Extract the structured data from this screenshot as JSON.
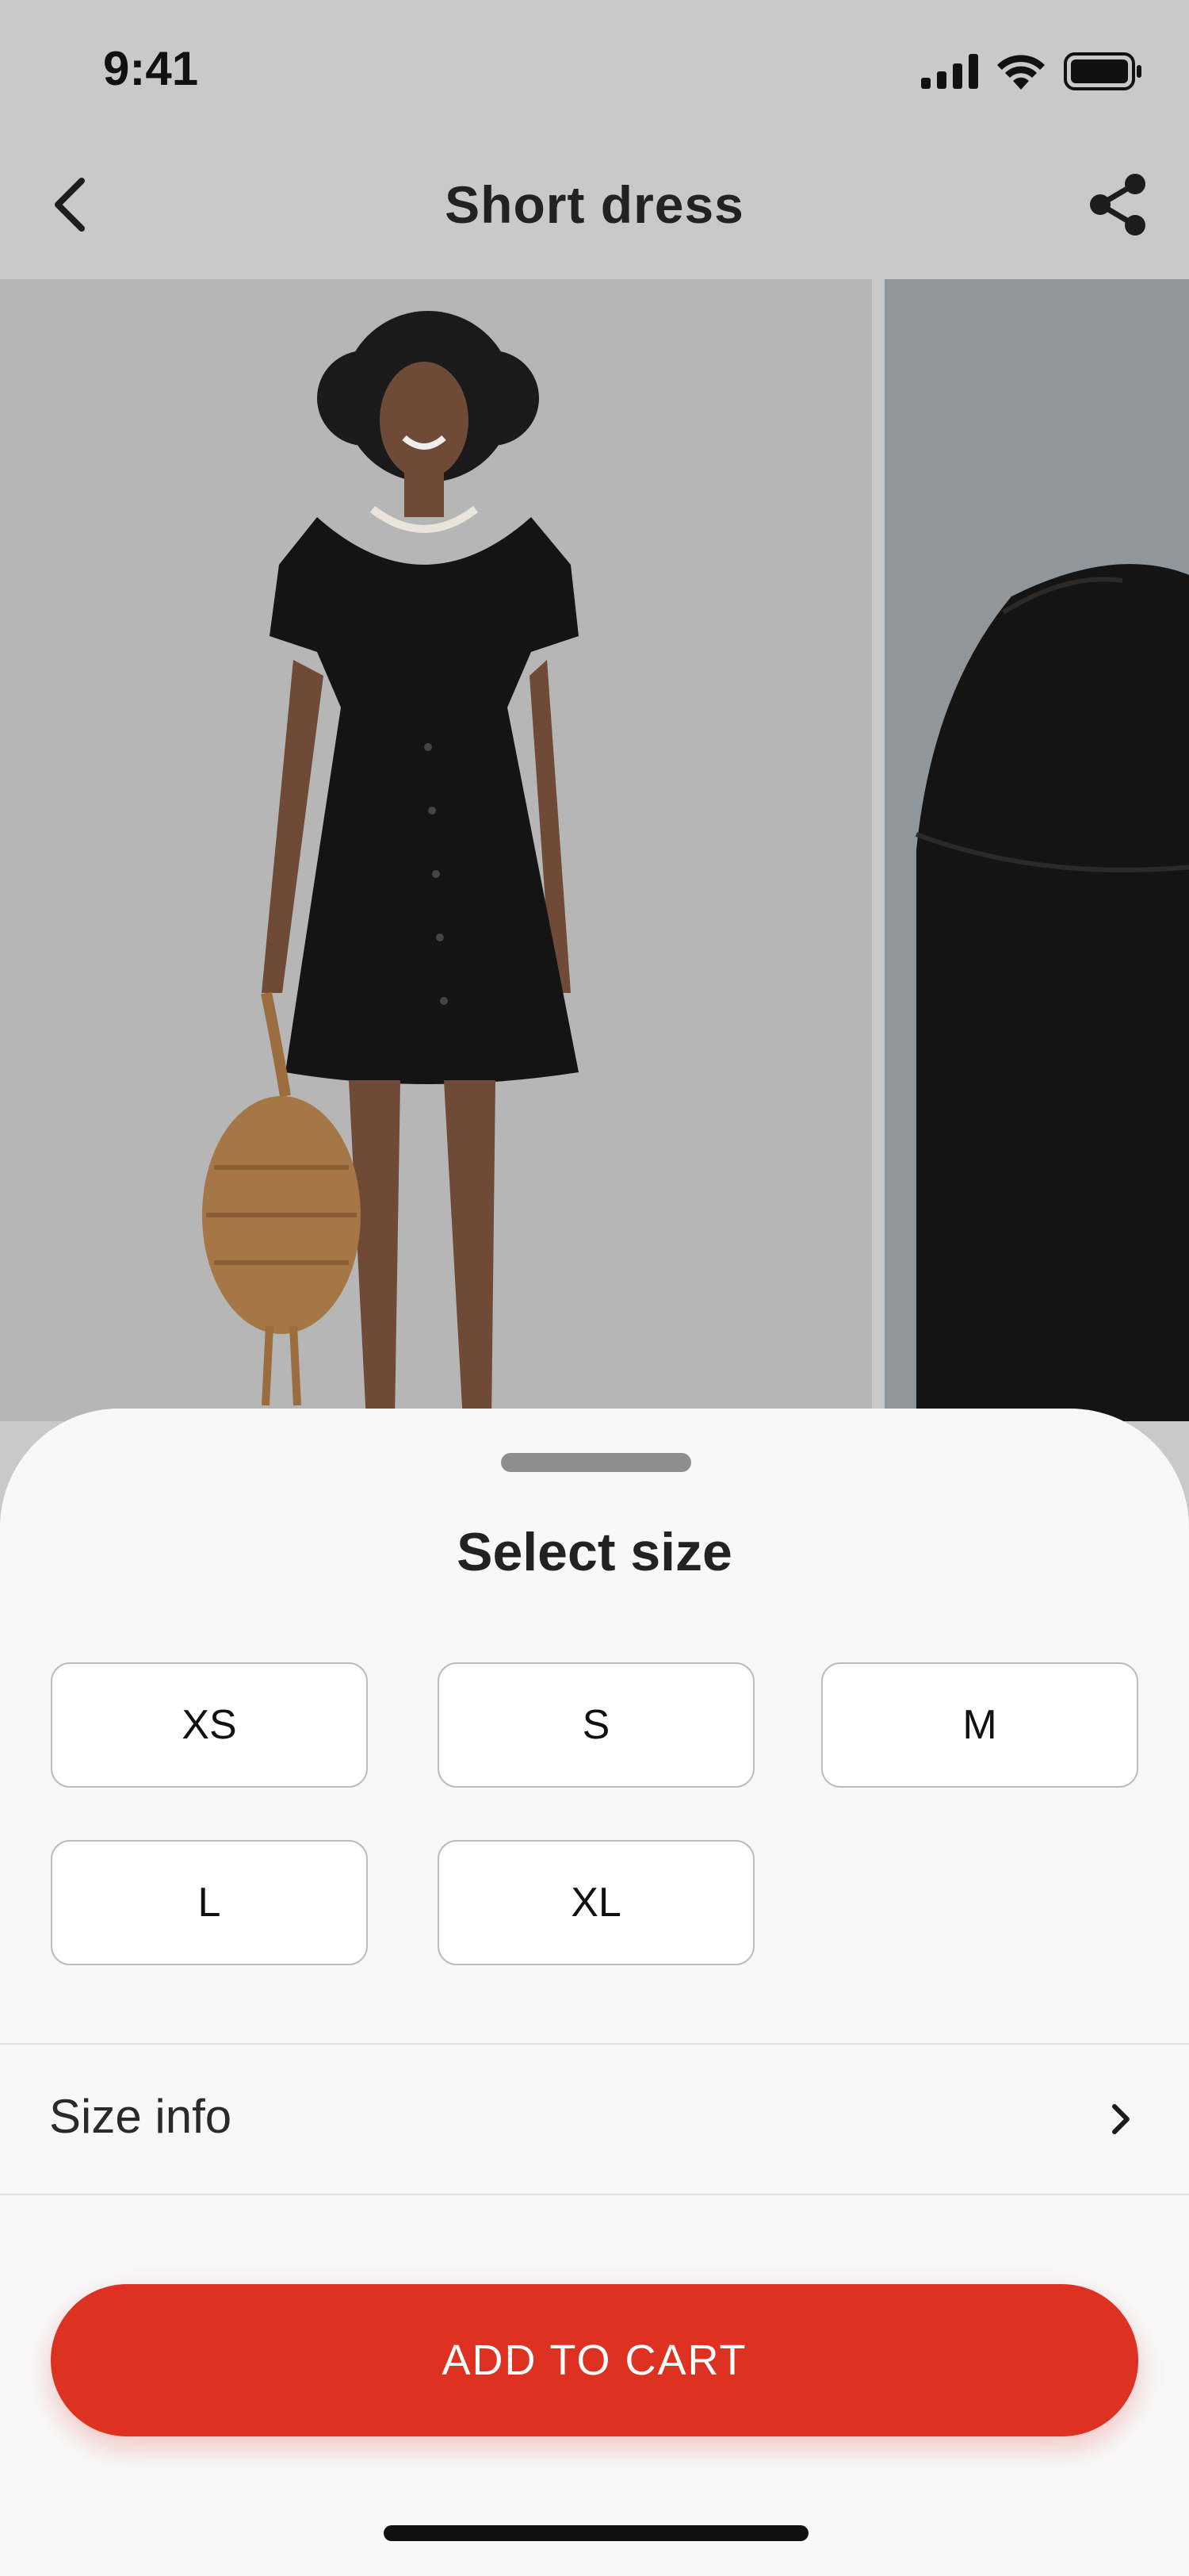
{
  "status_bar": {
    "time": "9:41",
    "icons": [
      "cellular-signal-icon",
      "wifi-icon",
      "battery-icon"
    ]
  },
  "nav": {
    "title": "Short dress",
    "back_icon": "chevron-left-icon",
    "share_icon": "share-icon"
  },
  "gallery": {
    "images": [
      "model-in-black-short-dress-full-body",
      "black-dress-sleeve-closeup"
    ]
  },
  "size_sheet": {
    "title": "Select size",
    "sizes": [
      "XS",
      "S",
      "M",
      "L",
      "XL"
    ],
    "size_info_label": "Size info",
    "add_to_cart_label": "ADD TO CART"
  },
  "colors": {
    "accent": "#dd3122",
    "sheet_background": "#f8f8f8",
    "overlay_background": "#c9c9c9"
  }
}
